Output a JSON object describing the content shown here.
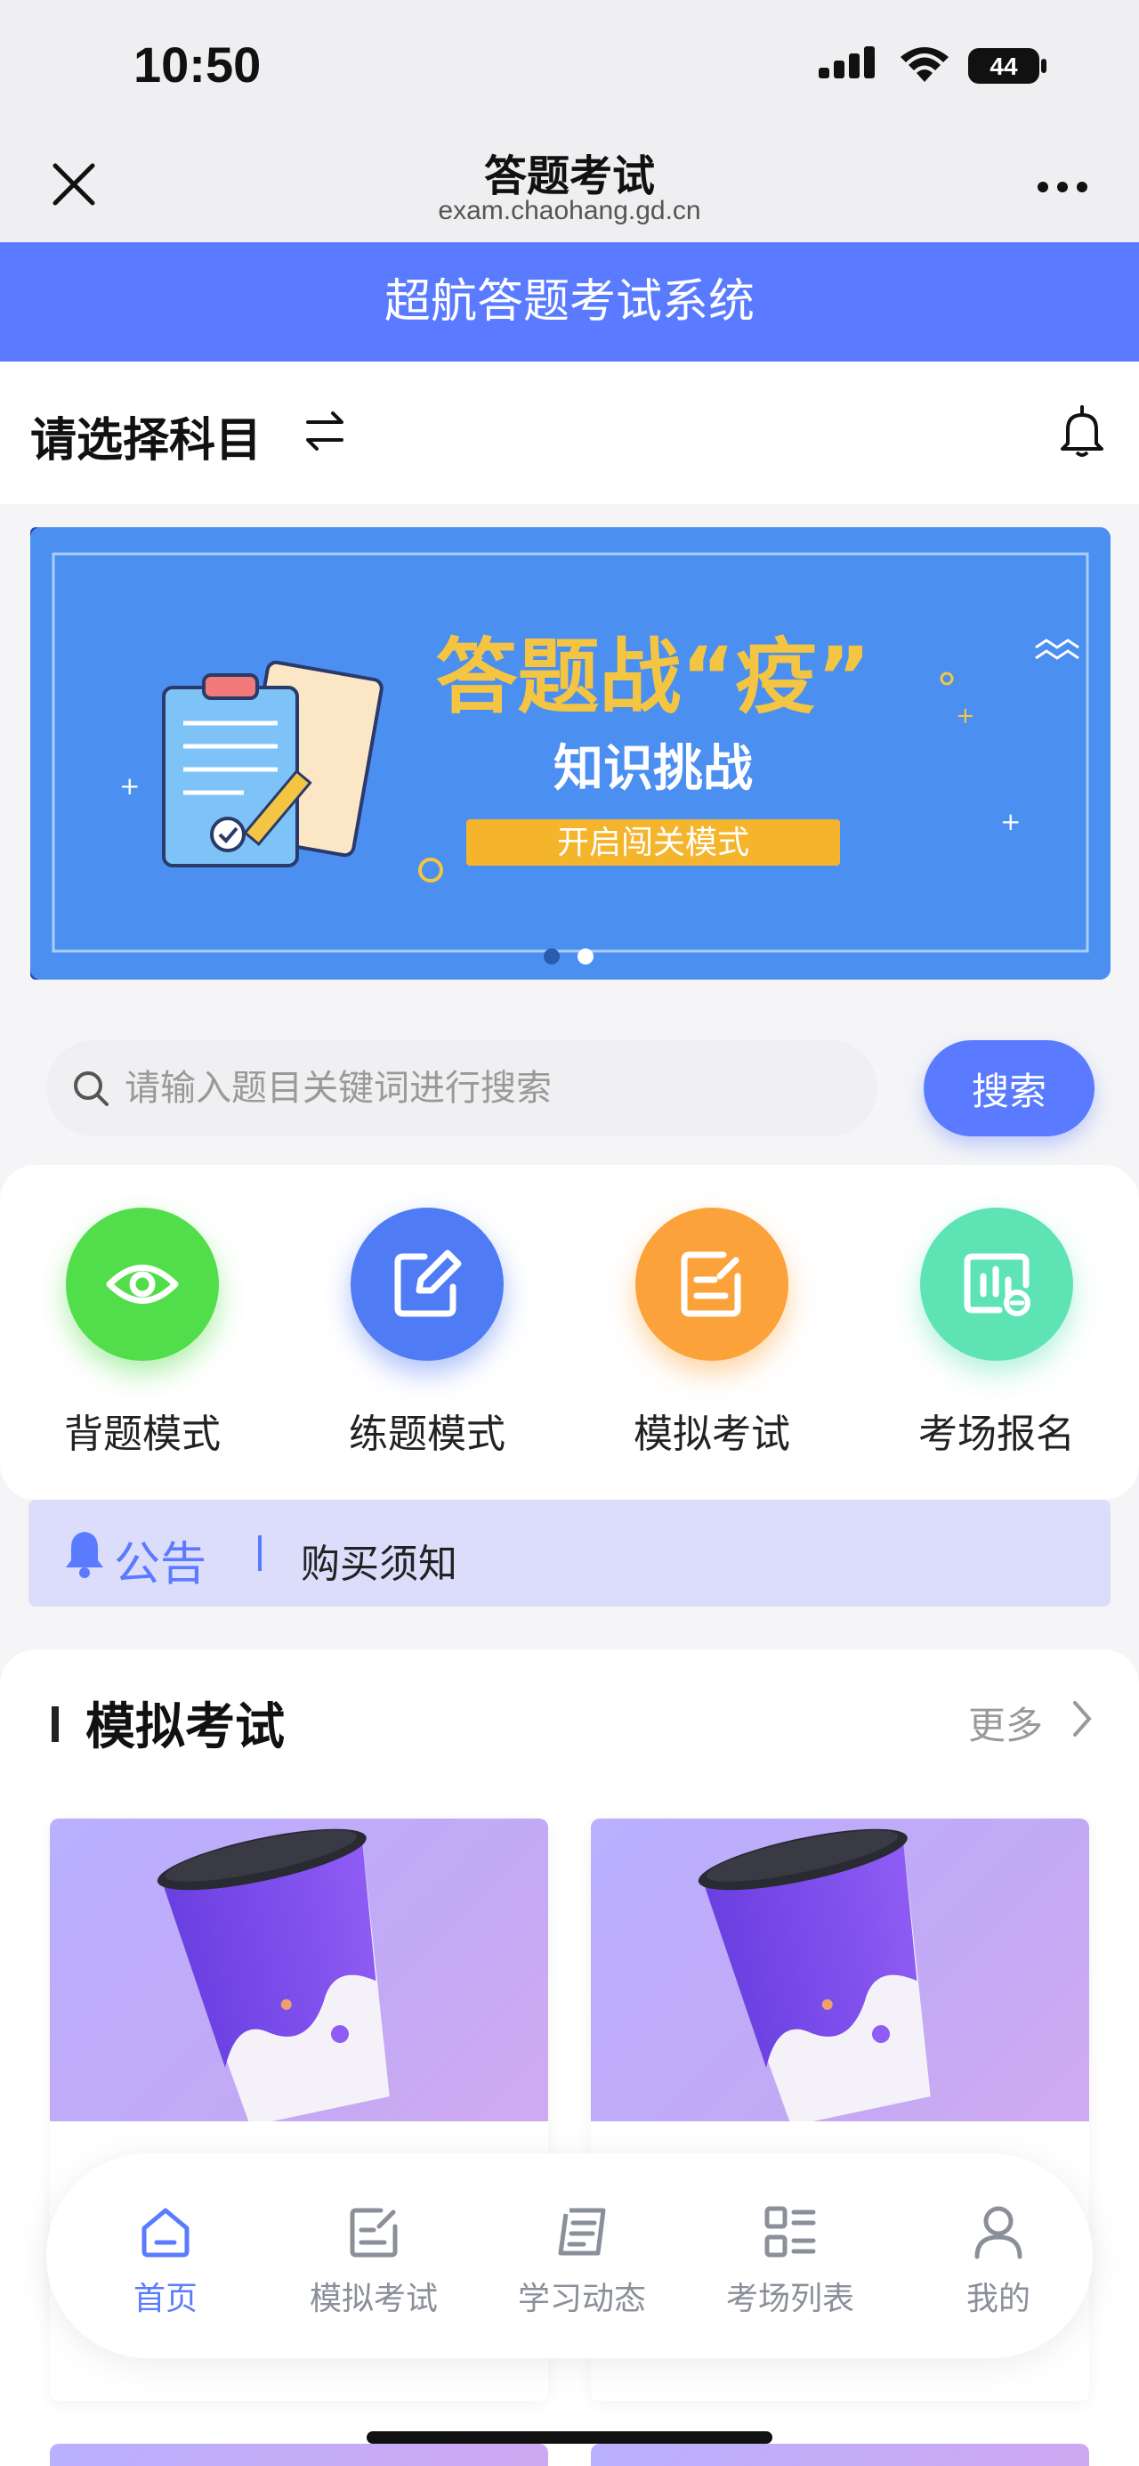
{
  "status_bar": {
    "time": "10:50",
    "battery": "44"
  },
  "nav": {
    "title": "答题考试",
    "url": "exam.chaohang.gd.cn"
  },
  "app_bar": {
    "title": "超航答题考试系统"
  },
  "subject": {
    "label": "请选择科目"
  },
  "banner": {
    "headline": "答题战“疫”",
    "subtitle": "知识挑战",
    "cta": "开启闯关模式",
    "slides": 2,
    "active_slide": 2
  },
  "search": {
    "placeholder": "请输入题目关键词进行搜索",
    "button": "搜索"
  },
  "modes": [
    {
      "label": "背题模式",
      "icon": "eye-icon",
      "color": "#52dd4a"
    },
    {
      "label": "练题模式",
      "icon": "edit-icon",
      "color": "#4f7bf5"
    },
    {
      "label": "模拟考试",
      "icon": "exam-paper-icon",
      "color": "#fca23b"
    },
    {
      "label": "考场报名",
      "icon": "chart-board-icon",
      "color": "#5ee3b4"
    }
  ],
  "notice": {
    "tag": "公告",
    "text": "购买须知"
  },
  "exam_section": {
    "title": "模拟考试",
    "more": "更多"
  },
  "tabs": [
    {
      "label": "首页",
      "icon": "home-icon",
      "active": true
    },
    {
      "label": "模拟考试",
      "icon": "exam-edit-icon",
      "active": false
    },
    {
      "label": "学习动态",
      "icon": "news-icon",
      "active": false
    },
    {
      "label": "考场列表",
      "icon": "list-grid-icon",
      "active": false
    },
    {
      "label": "我的",
      "icon": "user-icon",
      "active": false
    }
  ],
  "colors": {
    "brand": "#5a7bff",
    "notice_bg": "#dcdcfb"
  }
}
